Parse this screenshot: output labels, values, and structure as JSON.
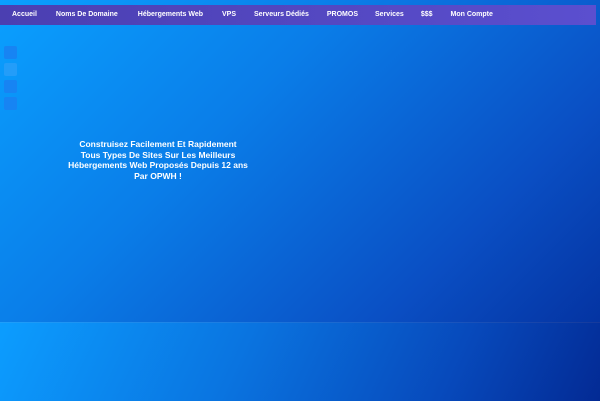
{
  "nav": {
    "items": [
      {
        "label": "Accueil"
      },
      {
        "label": "Noms De Domaine"
      },
      {
        "label": "Hébergements Web"
      },
      {
        "label": "VPS"
      },
      {
        "label": "Serveurs Dédiés"
      },
      {
        "label": "PROMOS"
      },
      {
        "label": "Services"
      },
      {
        "label": "$$$"
      },
      {
        "label": "Mon Compte"
      }
    ]
  },
  "hero": {
    "lines": [
      "Construisez Facilement Et Rapidement",
      "Tous Types De Sites Sur Les Meilleurs",
      "Hébergements Web Proposés Depuis 12 ans",
      "Par OPWH !"
    ]
  },
  "colors": {
    "nav_bg": "#5147c4",
    "background_start": "#0aa0ff",
    "background_end": "#022a96"
  }
}
